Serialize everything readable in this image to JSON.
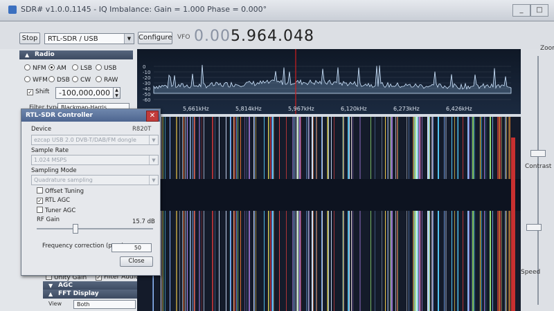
{
  "window": {
    "title": "SDR# v1.0.0.1145 - IQ Imbalance: Gain = 1.000 Phase = 0.000°",
    "minimize": "_",
    "maximize": "□"
  },
  "toolbar": {
    "stop_label": "Stop",
    "device_select": "RTL-SDR / USB",
    "configure_label": "Configure",
    "vfo_label": "VFO",
    "vfo_dim": "0.00",
    "vfo_bright": "5.964.048"
  },
  "radio": {
    "header": "Radio",
    "modes_row1": [
      "NFM",
      "AM",
      "LSB",
      "USB"
    ],
    "modes_row2": [
      "WFM",
      "DSB",
      "CW",
      "RAW"
    ],
    "selected_mode": "AM",
    "shift_label": "Shift",
    "shift_value": "-100,000,000",
    "filter_label": "Filter type",
    "filter_value": "Blackman-Harris"
  },
  "audio": {
    "unity_gain": "Unity Gain",
    "filter_audio": "Filter Audio"
  },
  "agc": {
    "header": "AGC"
  },
  "fft": {
    "header": "FFT Display",
    "view_label": "View",
    "view_value": "Both"
  },
  "spectrum": {
    "db_labels": [
      "0",
      "-10",
      "-20",
      "-30",
      "-40",
      "-50",
      "-60"
    ],
    "freq_labels": [
      "5,661kHz",
      "5,814kHz",
      "5,967kHz",
      "6,120kHz",
      "6,273kHz",
      "6,426kHz"
    ]
  },
  "right_panel": {
    "zoom": "Zoom",
    "contrast": "Contrast",
    "speed": "Speed"
  },
  "rtl_dialog": {
    "title": "RTL-SDR Controller",
    "device_label": "Device",
    "tuner": "R820T",
    "device_value": "ezcap USB 2.0 DVB-T/DAB/FM dongle",
    "sample_rate_label": "Sample Rate",
    "sample_rate_value": "1.024 MSPS",
    "sampling_mode_label": "Sampling Mode",
    "sampling_mode_value": "Quadrature sampling",
    "offset_tuning": "Offset Tuning",
    "rtl_agc": "RTL AGC",
    "tuner_agc": "Tuner AGC",
    "rf_gain_label": "RF Gain",
    "rf_gain_value": "15.7 dB",
    "freq_corr_label": "Frequency correction (ppm)",
    "freq_corr_value": "50",
    "close_label": "Close"
  },
  "colors": {
    "accent": "#4d6590",
    "spectrum_trace": "#cfe6ff",
    "center_marker": "#d21e1e",
    "close_red": "#c23b3b"
  }
}
